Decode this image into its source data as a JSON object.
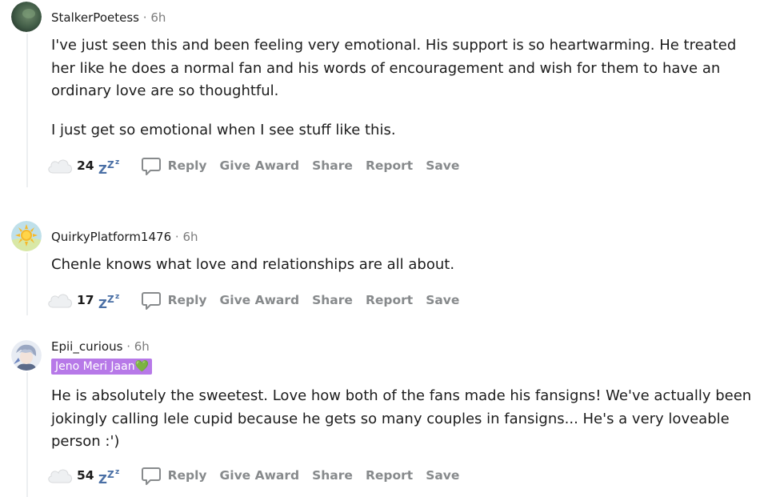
{
  "comments": [
    {
      "username": "StalkerPoetess",
      "separator": "·",
      "time": "6h",
      "avatar_icon": "user-avatar-icon",
      "paragraphs": [
        "I've just seen this and been feeling very emotional. His support is so heartwarming. He treated her like he does a normal fan and his words of encouragement and wish for them to have an ordinary love are so thoughtful.",
        "I just get so emotional when I see stuff like this."
      ],
      "score": "24",
      "actions": {
        "reply": "Reply",
        "give_award": "Give Award",
        "share": "Share",
        "report": "Report",
        "save": "Save"
      }
    },
    {
      "username": "QuirkyPlatform1476",
      "separator": "·",
      "time": "6h",
      "avatar_icon": "sun-avatar-icon",
      "paragraphs": [
        "Chenle knows what love and relationships are all about."
      ],
      "score": "17",
      "actions": {
        "reply": "Reply",
        "give_award": "Give Award",
        "share": "Share",
        "report": "Report",
        "save": "Save"
      }
    },
    {
      "username": "Epii_curious",
      "separator": "·",
      "time": "6h",
      "avatar_icon": "user-avatar-icon",
      "flair": "Jeno Meri Jaan💚",
      "paragraphs": [
        "He is absolutely the sweetest. Love how both of the fans made his fansigns! We've actually been jokingly calling lele cupid because he gets so many couples in fansigns... He's a very loveable person :')"
      ],
      "score": "54",
      "actions": {
        "reply": "Reply",
        "give_award": "Give Award",
        "share": "Share",
        "report": "Report",
        "save": "Save"
      }
    }
  ],
  "colors": {
    "flair_bg": "#b779e8",
    "meta_gray": "#7c7c7c",
    "action_gray": "#878a8c",
    "zzz_blue": "#4a6fa5",
    "thread_line": "#edeff1"
  }
}
